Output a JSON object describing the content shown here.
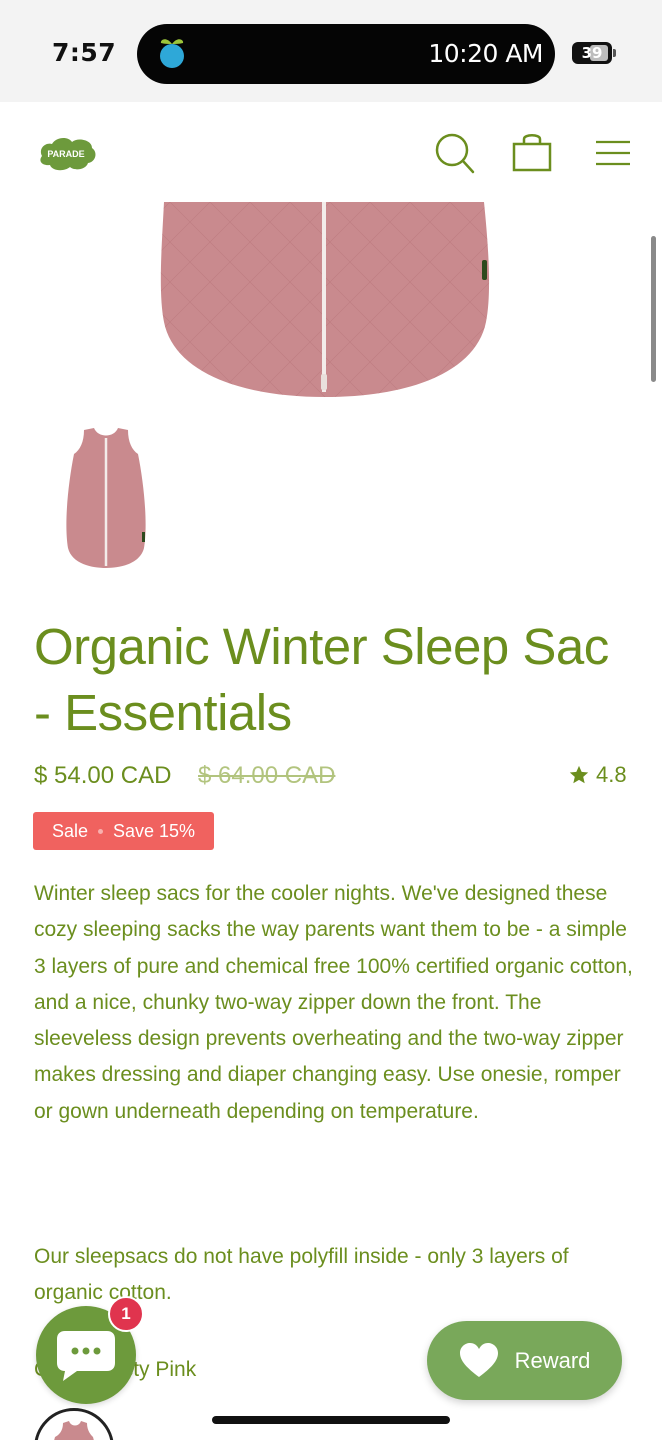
{
  "status_bar": {
    "time": "7:57",
    "island_time": "10:20 AM",
    "battery": "39"
  },
  "header": {
    "logo_text": "PARADE",
    "icons": [
      "search-icon",
      "shopping-bag-icon",
      "menu-icon"
    ]
  },
  "product": {
    "title": "Organic Winter Sleep Sac - Essentials",
    "price": "$ 54.00 CAD",
    "compare_price": "$ 64.00 CAD",
    "rating": "4.8",
    "badge_sale": "Sale",
    "badge_save": "Save 15%",
    "description": "Winter sleep sacs for the cooler nights. We've designed these cozy sleeping sacks the way parents want them to be - a simple 3 layers of pure and chemical free 100% certified organic cotton, and a nice, chunky two-way zipper down the front. The sleeveless design prevents overheating and the two-way zipper makes dressing and diaper changing easy. Use onesie, romper or gown underneath depending on temperature.",
    "description_2": "Our sleepsacs do not have polyfill inside - only 3 layers of organic cotton.",
    "color_label": "Color: Dusty Pink"
  },
  "chat": {
    "badge_count": "1"
  },
  "reward": {
    "label": "Reward"
  },
  "colors": {
    "brand_green": "#6b8e1e",
    "sale_red": "#f0625f",
    "reward_green": "#79a85a",
    "chat_green": "#6d9a3c",
    "product_pink": "#c98a8e"
  }
}
